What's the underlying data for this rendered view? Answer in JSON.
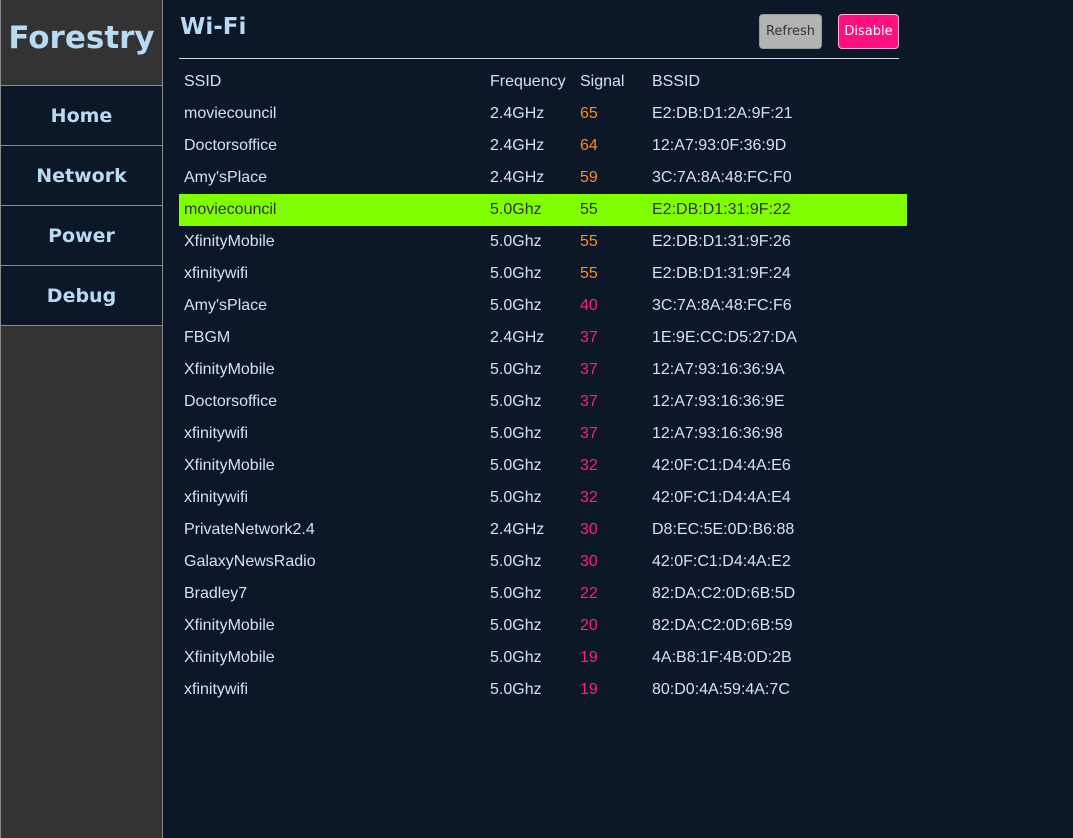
{
  "app": {
    "brand": "Forestry"
  },
  "nav": {
    "items": [
      {
        "label": "Home"
      },
      {
        "label": "Network"
      },
      {
        "label": "Power"
      },
      {
        "label": "Debug"
      }
    ]
  },
  "header": {
    "title": "Wi-Fi",
    "refresh_label": "Refresh",
    "disable_label": "Disable"
  },
  "colors": {
    "background": "#0c1727",
    "sidebar": "#333333",
    "text": "#b8daf3",
    "highlight_row": "#7fff00",
    "signal_medium": "#ff8c1a",
    "signal_low": "#ff1f7a",
    "disable_button": "#ff0f80",
    "refresh_button": "#b3b3b3"
  },
  "table": {
    "headers": {
      "ssid": "SSID",
      "frequency": "Frequency",
      "signal": "Signal",
      "bssid": "BSSID"
    },
    "rows": [
      {
        "ssid": "moviecouncil",
        "frequency": "2.4GHz",
        "signal": "65",
        "bssid": "E2:DB:D1:2A:9F:21",
        "highlighted": false
      },
      {
        "ssid": "Doctorsoffice",
        "frequency": "2.4GHz",
        "signal": "64",
        "bssid": "12:A7:93:0F:36:9D",
        "highlighted": false
      },
      {
        "ssid": "Amy'sPlace",
        "frequency": "2.4GHz",
        "signal": "59",
        "bssid": "3C:7A:8A:48:FC:F0",
        "highlighted": false
      },
      {
        "ssid": "moviecouncil",
        "frequency": "5.0Ghz",
        "signal": "55",
        "bssid": "E2:DB:D1:31:9F:22",
        "highlighted": true
      },
      {
        "ssid": "XfinityMobile",
        "frequency": "5.0Ghz",
        "signal": "55",
        "bssid": "E2:DB:D1:31:9F:26",
        "highlighted": false
      },
      {
        "ssid": "xfinitywifi",
        "frequency": "5.0Ghz",
        "signal": "55",
        "bssid": "E2:DB:D1:31:9F:24",
        "highlighted": false
      },
      {
        "ssid": "Amy'sPlace",
        "frequency": "5.0Ghz",
        "signal": "40",
        "bssid": "3C:7A:8A:48:FC:F6",
        "highlighted": false
      },
      {
        "ssid": "FBGM",
        "frequency": "2.4GHz",
        "signal": "37",
        "bssid": "1E:9E:CC:D5:27:DA",
        "highlighted": false
      },
      {
        "ssid": "XfinityMobile",
        "frequency": "5.0Ghz",
        "signal": "37",
        "bssid": "12:A7:93:16:36:9A",
        "highlighted": false
      },
      {
        "ssid": "Doctorsoffice",
        "frequency": "5.0Ghz",
        "signal": "37",
        "bssid": "12:A7:93:16:36:9E",
        "highlighted": false
      },
      {
        "ssid": "xfinitywifi",
        "frequency": "5.0Ghz",
        "signal": "37",
        "bssid": "12:A7:93:16:36:98",
        "highlighted": false
      },
      {
        "ssid": "XfinityMobile",
        "frequency": "5.0Ghz",
        "signal": "32",
        "bssid": "42:0F:C1:D4:4A:E6",
        "highlighted": false
      },
      {
        "ssid": "xfinitywifi",
        "frequency": "5.0Ghz",
        "signal": "32",
        "bssid": "42:0F:C1:D4:4A:E4",
        "highlighted": false
      },
      {
        "ssid": "PrivateNetwork2.4",
        "frequency": "2.4GHz",
        "signal": "30",
        "bssid": "D8:EC:5E:0D:B6:88",
        "highlighted": false
      },
      {
        "ssid": "GalaxyNewsRadio",
        "frequency": "5.0Ghz",
        "signal": "30",
        "bssid": "42:0F:C1:D4:4A:E2",
        "highlighted": false
      },
      {
        "ssid": "Bradley7",
        "frequency": "5.0Ghz",
        "signal": "22",
        "bssid": "82:DA:C2:0D:6B:5D",
        "highlighted": false
      },
      {
        "ssid": "XfinityMobile",
        "frequency": "5.0Ghz",
        "signal": "20",
        "bssid": "82:DA:C2:0D:6B:59",
        "highlighted": false
      },
      {
        "ssid": "XfinityMobile",
        "frequency": "5.0Ghz",
        "signal": "19",
        "bssid": "4A:B8:1F:4B:0D:2B",
        "highlighted": false
      },
      {
        "ssid": "xfinitywifi",
        "frequency": "5.0Ghz",
        "signal": "19",
        "bssid": "80:D0:4A:59:4A:7C",
        "highlighted": false
      }
    ]
  }
}
